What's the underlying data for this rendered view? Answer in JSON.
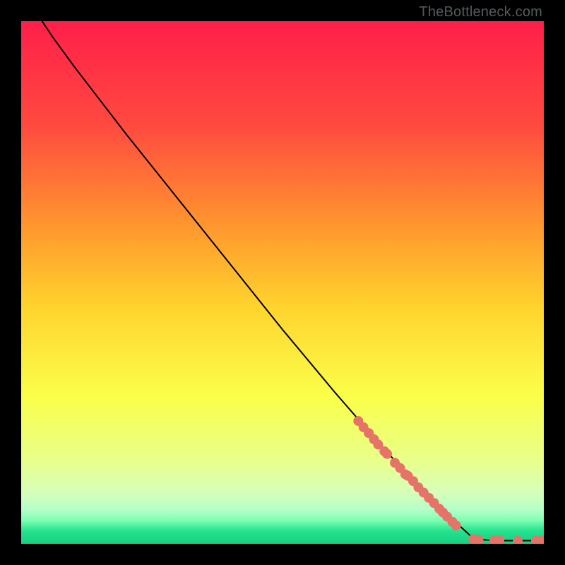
{
  "watermark": "TheBottleneck.com",
  "chart_data": {
    "type": "line",
    "xlim": [
      0,
      100
    ],
    "ylim": [
      0,
      100
    ],
    "grid": false,
    "legend": false,
    "title": "",
    "xlabel": "",
    "ylabel": "",
    "background_gradient_stops": [
      {
        "offset": 0.0,
        "color": "#ff1f4a"
      },
      {
        "offset": 0.2,
        "color": "#ff4a3f"
      },
      {
        "offset": 0.4,
        "color": "#ff9a2e"
      },
      {
        "offset": 0.55,
        "color": "#ffd52e"
      },
      {
        "offset": 0.72,
        "color": "#faff4a"
      },
      {
        "offset": 0.84,
        "color": "#e8ff8a"
      },
      {
        "offset": 0.9,
        "color": "#d7ffb8"
      },
      {
        "offset": 0.935,
        "color": "#b4ffc8"
      },
      {
        "offset": 0.955,
        "color": "#7dffb2"
      },
      {
        "offset": 0.975,
        "color": "#25e38e"
      },
      {
        "offset": 1.0,
        "color": "#18cf82"
      }
    ],
    "curve": {
      "color": "#000000",
      "width": 2,
      "points": [
        {
          "x": 4.0,
          "y": 100.0
        },
        {
          "x": 6.0,
          "y": 97.0
        },
        {
          "x": 10.0,
          "y": 91.5
        },
        {
          "x": 15.0,
          "y": 85.0
        },
        {
          "x": 20.0,
          "y": 78.5
        },
        {
          "x": 30.0,
          "y": 66.0
        },
        {
          "x": 40.0,
          "y": 53.5
        },
        {
          "x": 50.0,
          "y": 41.0
        },
        {
          "x": 60.0,
          "y": 29.0
        },
        {
          "x": 70.0,
          "y": 17.5
        },
        {
          "x": 80.0,
          "y": 7.0
        },
        {
          "x": 86.0,
          "y": 1.5
        },
        {
          "x": 88.0,
          "y": 0.8
        },
        {
          "x": 92.0,
          "y": 0.6
        },
        {
          "x": 96.0,
          "y": 0.6
        },
        {
          "x": 100.0,
          "y": 0.6
        }
      ]
    },
    "markers": {
      "color": "#e57368",
      "radius": 7,
      "points": [
        {
          "x": 64.5,
          "y": 23.5
        },
        {
          "x": 65.5,
          "y": 22.3
        },
        {
          "x": 66.5,
          "y": 21.2
        },
        {
          "x": 67.5,
          "y": 20.0
        },
        {
          "x": 68.3,
          "y": 19.0
        },
        {
          "x": 69.5,
          "y": 17.7
        },
        {
          "x": 70.0,
          "y": 17.2
        },
        {
          "x": 71.5,
          "y": 15.5
        },
        {
          "x": 72.5,
          "y": 14.5
        },
        {
          "x": 73.5,
          "y": 13.3
        },
        {
          "x": 74.0,
          "y": 13.0
        },
        {
          "x": 75.0,
          "y": 12.0
        },
        {
          "x": 76.0,
          "y": 10.8
        },
        {
          "x": 77.0,
          "y": 9.8
        },
        {
          "x": 78.0,
          "y": 8.8
        },
        {
          "x": 79.0,
          "y": 7.8
        },
        {
          "x": 80.0,
          "y": 6.7
        },
        {
          "x": 80.7,
          "y": 6.0
        },
        {
          "x": 81.5,
          "y": 5.2
        },
        {
          "x": 82.5,
          "y": 4.2
        },
        {
          "x": 83.2,
          "y": 3.5
        },
        {
          "x": 86.5,
          "y": 0.9
        },
        {
          "x": 87.5,
          "y": 0.8
        },
        {
          "x": 90.5,
          "y": 0.7
        },
        {
          "x": 91.5,
          "y": 0.7
        },
        {
          "x": 95.0,
          "y": 0.6
        },
        {
          "x": 98.5,
          "y": 0.6
        },
        {
          "x": 99.5,
          "y": 0.6
        }
      ]
    }
  }
}
